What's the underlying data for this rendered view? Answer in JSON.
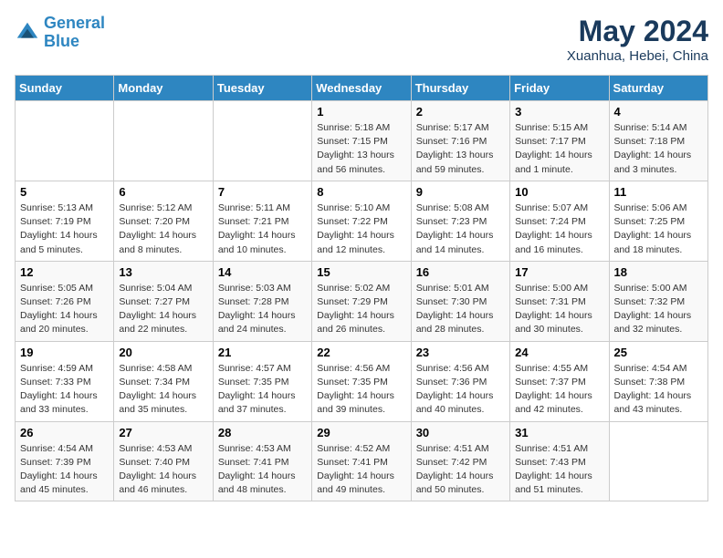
{
  "header": {
    "logo_line1": "General",
    "logo_line2": "Blue",
    "title": "May 2024",
    "location": "Xuanhua, Hebei, China"
  },
  "days_of_week": [
    "Sunday",
    "Monday",
    "Tuesday",
    "Wednesday",
    "Thursday",
    "Friday",
    "Saturday"
  ],
  "weeks": [
    [
      {
        "day": "",
        "info": ""
      },
      {
        "day": "",
        "info": ""
      },
      {
        "day": "",
        "info": ""
      },
      {
        "day": "1",
        "info": "Sunrise: 5:18 AM\nSunset: 7:15 PM\nDaylight: 13 hours\nand 56 minutes."
      },
      {
        "day": "2",
        "info": "Sunrise: 5:17 AM\nSunset: 7:16 PM\nDaylight: 13 hours\nand 59 minutes."
      },
      {
        "day": "3",
        "info": "Sunrise: 5:15 AM\nSunset: 7:17 PM\nDaylight: 14 hours\nand 1 minute."
      },
      {
        "day": "4",
        "info": "Sunrise: 5:14 AM\nSunset: 7:18 PM\nDaylight: 14 hours\nand 3 minutes."
      }
    ],
    [
      {
        "day": "5",
        "info": "Sunrise: 5:13 AM\nSunset: 7:19 PM\nDaylight: 14 hours\nand 5 minutes."
      },
      {
        "day": "6",
        "info": "Sunrise: 5:12 AM\nSunset: 7:20 PM\nDaylight: 14 hours\nand 8 minutes."
      },
      {
        "day": "7",
        "info": "Sunrise: 5:11 AM\nSunset: 7:21 PM\nDaylight: 14 hours\nand 10 minutes."
      },
      {
        "day": "8",
        "info": "Sunrise: 5:10 AM\nSunset: 7:22 PM\nDaylight: 14 hours\nand 12 minutes."
      },
      {
        "day": "9",
        "info": "Sunrise: 5:08 AM\nSunset: 7:23 PM\nDaylight: 14 hours\nand 14 minutes."
      },
      {
        "day": "10",
        "info": "Sunrise: 5:07 AM\nSunset: 7:24 PM\nDaylight: 14 hours\nand 16 minutes."
      },
      {
        "day": "11",
        "info": "Sunrise: 5:06 AM\nSunset: 7:25 PM\nDaylight: 14 hours\nand 18 minutes."
      }
    ],
    [
      {
        "day": "12",
        "info": "Sunrise: 5:05 AM\nSunset: 7:26 PM\nDaylight: 14 hours\nand 20 minutes."
      },
      {
        "day": "13",
        "info": "Sunrise: 5:04 AM\nSunset: 7:27 PM\nDaylight: 14 hours\nand 22 minutes."
      },
      {
        "day": "14",
        "info": "Sunrise: 5:03 AM\nSunset: 7:28 PM\nDaylight: 14 hours\nand 24 minutes."
      },
      {
        "day": "15",
        "info": "Sunrise: 5:02 AM\nSunset: 7:29 PM\nDaylight: 14 hours\nand 26 minutes."
      },
      {
        "day": "16",
        "info": "Sunrise: 5:01 AM\nSunset: 7:30 PM\nDaylight: 14 hours\nand 28 minutes."
      },
      {
        "day": "17",
        "info": "Sunrise: 5:00 AM\nSunset: 7:31 PM\nDaylight: 14 hours\nand 30 minutes."
      },
      {
        "day": "18",
        "info": "Sunrise: 5:00 AM\nSunset: 7:32 PM\nDaylight: 14 hours\nand 32 minutes."
      }
    ],
    [
      {
        "day": "19",
        "info": "Sunrise: 4:59 AM\nSunset: 7:33 PM\nDaylight: 14 hours\nand 33 minutes."
      },
      {
        "day": "20",
        "info": "Sunrise: 4:58 AM\nSunset: 7:34 PM\nDaylight: 14 hours\nand 35 minutes."
      },
      {
        "day": "21",
        "info": "Sunrise: 4:57 AM\nSunset: 7:35 PM\nDaylight: 14 hours\nand 37 minutes."
      },
      {
        "day": "22",
        "info": "Sunrise: 4:56 AM\nSunset: 7:35 PM\nDaylight: 14 hours\nand 39 minutes."
      },
      {
        "day": "23",
        "info": "Sunrise: 4:56 AM\nSunset: 7:36 PM\nDaylight: 14 hours\nand 40 minutes."
      },
      {
        "day": "24",
        "info": "Sunrise: 4:55 AM\nSunset: 7:37 PM\nDaylight: 14 hours\nand 42 minutes."
      },
      {
        "day": "25",
        "info": "Sunrise: 4:54 AM\nSunset: 7:38 PM\nDaylight: 14 hours\nand 43 minutes."
      }
    ],
    [
      {
        "day": "26",
        "info": "Sunrise: 4:54 AM\nSunset: 7:39 PM\nDaylight: 14 hours\nand 45 minutes."
      },
      {
        "day": "27",
        "info": "Sunrise: 4:53 AM\nSunset: 7:40 PM\nDaylight: 14 hours\nand 46 minutes."
      },
      {
        "day": "28",
        "info": "Sunrise: 4:53 AM\nSunset: 7:41 PM\nDaylight: 14 hours\nand 48 minutes."
      },
      {
        "day": "29",
        "info": "Sunrise: 4:52 AM\nSunset: 7:41 PM\nDaylight: 14 hours\nand 49 minutes."
      },
      {
        "day": "30",
        "info": "Sunrise: 4:51 AM\nSunset: 7:42 PM\nDaylight: 14 hours\nand 50 minutes."
      },
      {
        "day": "31",
        "info": "Sunrise: 4:51 AM\nSunset: 7:43 PM\nDaylight: 14 hours\nand 51 minutes."
      },
      {
        "day": "",
        "info": ""
      }
    ]
  ]
}
